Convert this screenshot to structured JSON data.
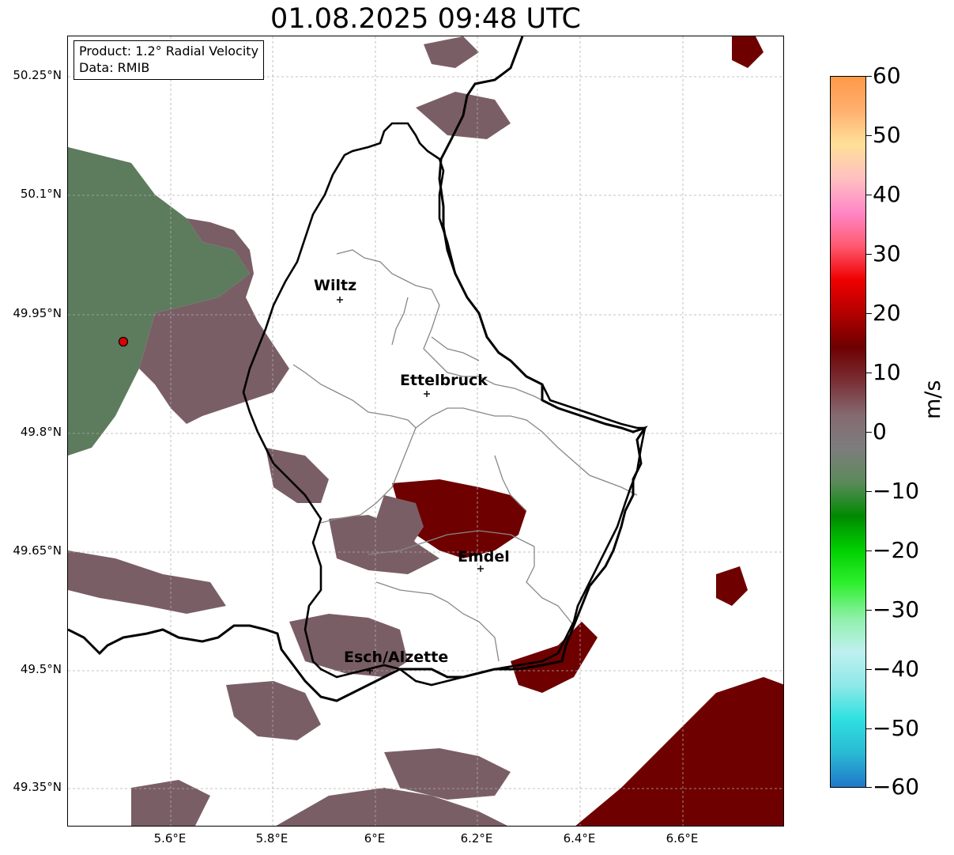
{
  "title": "01.08.2025 09:48 UTC",
  "info_box": {
    "product": "Product: 1.2° Radial Velocity",
    "data_source": "Data: RMIB"
  },
  "axes": {
    "lat_ticks": [
      "50.25°N",
      "50.1°N",
      "49.95°N",
      "49.8°N",
      "49.65°N",
      "49.5°N",
      "49.35°N"
    ],
    "lon_ticks": [
      "5.6°E",
      "5.8°E",
      "6°E",
      "6.2°E",
      "6.4°E",
      "6.6°E"
    ]
  },
  "cities": [
    {
      "name": "Wiltz"
    },
    {
      "name": "Ettelbruck"
    },
    {
      "name": "Emdel"
    },
    {
      "name": "Esch/Alzette"
    }
  ],
  "colorbar": {
    "label": "m/s",
    "ticks": [
      "60",
      "50",
      "40",
      "30",
      "20",
      "10",
      "0",
      "−10",
      "−20",
      "−30",
      "−40",
      "−50",
      "−60"
    ],
    "min": -60,
    "max": 60,
    "stops": [
      "#1f78c8",
      "#2ab9d4",
      "#2ee0e0",
      "#8ee8e8",
      "#bff0f0",
      "#8ef0a8",
      "#30f030",
      "#00d000",
      "#008a00",
      "#5a8a5a",
      "#7d7d7d",
      "#856a70",
      "#7a2f35",
      "#6e0000",
      "#b30000",
      "#f00000",
      "#ff5a70",
      "#ff88c8",
      "#ffc0c0",
      "#ffe098",
      "#ffb070",
      "#ff9848"
    ]
  },
  "colors": {
    "receding": "#7a5a62",
    "strong_receding": "#6e0000",
    "approaching": "#5d7b5d",
    "strong_approaching": "#2f6a2f",
    "radar_marker": "#e00000"
  }
}
